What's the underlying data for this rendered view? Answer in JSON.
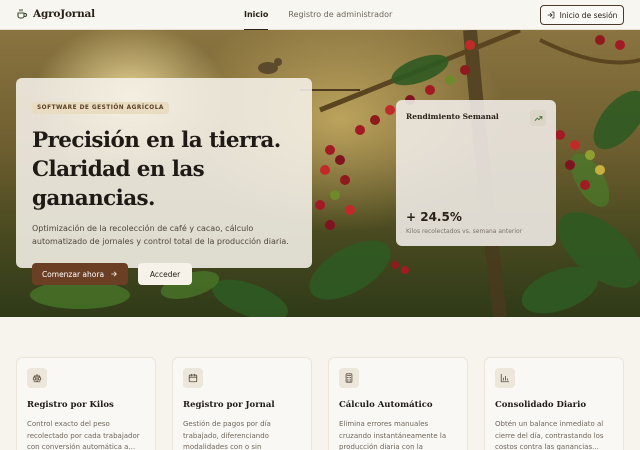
{
  "header": {
    "brand": "AgroJornal",
    "nav": [
      {
        "label": "Inicio"
      },
      {
        "label": "Registro de administrador"
      }
    ],
    "login_label": "Inicio de sesión"
  },
  "hero": {
    "badge": "SOFTWARE DE GESTIÓN AGRÍCOLA",
    "title_line1": "Precisión en la tierra.",
    "title_line2": "Claridad en las ganancias.",
    "description": "Optimización de la recolección de café y cacao, cálculo automatizado de jornales y control total de la producción diaria.",
    "primary_cta": "Comenzar ahora",
    "secondary_cta": "Acceder"
  },
  "performance": {
    "title": "Rendimiento Semanal",
    "value": "+ 24.5%",
    "subtitle": "Kilos recolectados vs. semana anterior"
  },
  "features": [
    {
      "icon": "scale-icon",
      "title": "Registro por Kilos",
      "description": "Control exacto del peso recolectado por cada trabajador con conversión automática a..."
    },
    {
      "icon": "calendar-icon",
      "title": "Registro por Jornal",
      "description": "Gestión de pagos por día trabajado, diferenciando modalidades con o sin alimentación incluida."
    },
    {
      "icon": "calculator-icon",
      "title": "Cálculo Automático",
      "description": "Elimina errores manuales cruzando instantáneamente la producción diaria con la configuración de..."
    },
    {
      "icon": "bar-chart-icon",
      "title": "Consolidado Diario",
      "description": "Obtén un balance inmediato al cierre del día, contrastando los costos contra las ganancias..."
    }
  ],
  "colors": {
    "primary_button": "#6b3f24",
    "badge_bg": "#e9dcc2",
    "page_bg": "#f7f4ee"
  }
}
